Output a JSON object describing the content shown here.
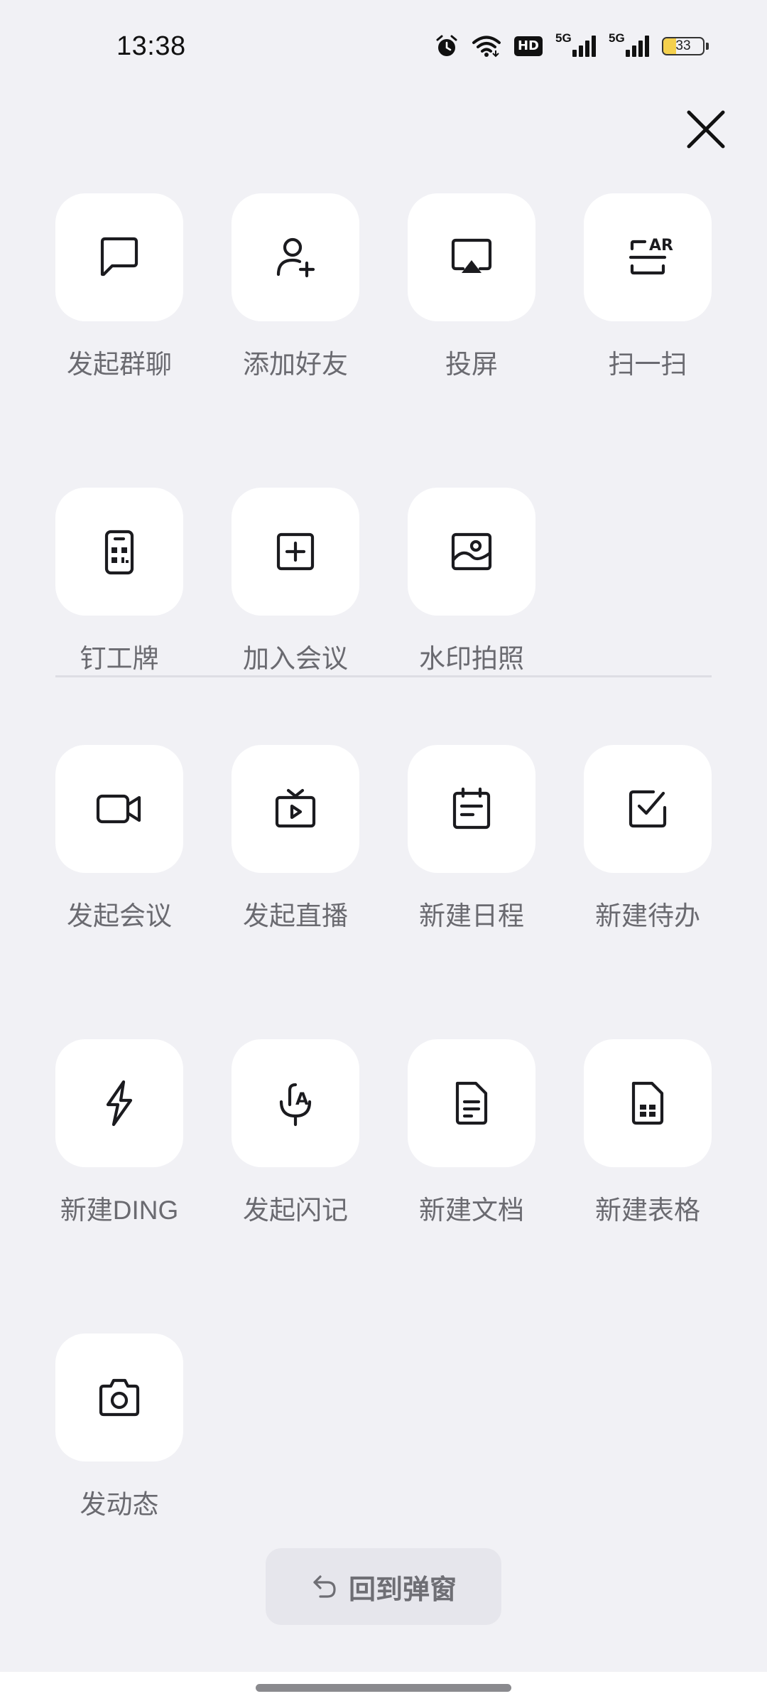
{
  "status_bar": {
    "time": "13:38",
    "icons": [
      "alarm-icon",
      "wifi-icon",
      "hd-voice-icon",
      "signal-5g-icon",
      "signal-5g-icon",
      "battery-icon"
    ],
    "hd_label": "HD",
    "network_1": "5G",
    "network_2": "5G",
    "battery_level": "33",
    "battery_fraction": 0.33,
    "battery_color": "#f4d04d"
  },
  "close_icon": "close-icon",
  "section_quick": [
    {
      "label": "发起群聊",
      "icon": "chat-bubble-icon"
    },
    {
      "label": "添加好友",
      "icon": "add-user-icon"
    },
    {
      "label": "投屏",
      "icon": "screen-cast-icon"
    },
    {
      "label": "扫一扫",
      "icon": "ar-scan-icon"
    },
    {
      "label": "钉工牌",
      "icon": "badge-card-icon"
    },
    {
      "label": "加入会议",
      "icon": "plus-square-icon"
    },
    {
      "label": "水印拍照",
      "icon": "watermark-photo-icon"
    }
  ],
  "section_create": [
    {
      "label": "发起会议",
      "icon": "video-camera-icon"
    },
    {
      "label": "发起直播",
      "icon": "live-tv-icon"
    },
    {
      "label": "新建日程",
      "icon": "calendar-icon"
    },
    {
      "label": "新建待办",
      "icon": "checkbox-icon"
    },
    {
      "label": "新建DING",
      "icon": "lightning-icon"
    },
    {
      "label": "发起闪记",
      "icon": "mic-text-icon"
    },
    {
      "label": "新建文档",
      "icon": "document-icon"
    },
    {
      "label": "新建表格",
      "icon": "spreadsheet-icon"
    },
    {
      "label": "发动态",
      "icon": "camera-icon"
    }
  ],
  "return_button": {
    "label": "回到弹窗",
    "icon": "return-arrow-icon"
  },
  "colors": {
    "background": "#f1f1f5",
    "tile": "#ffffff",
    "label_text": "#6a6a70",
    "icon_stroke": "#1b1b1f"
  }
}
